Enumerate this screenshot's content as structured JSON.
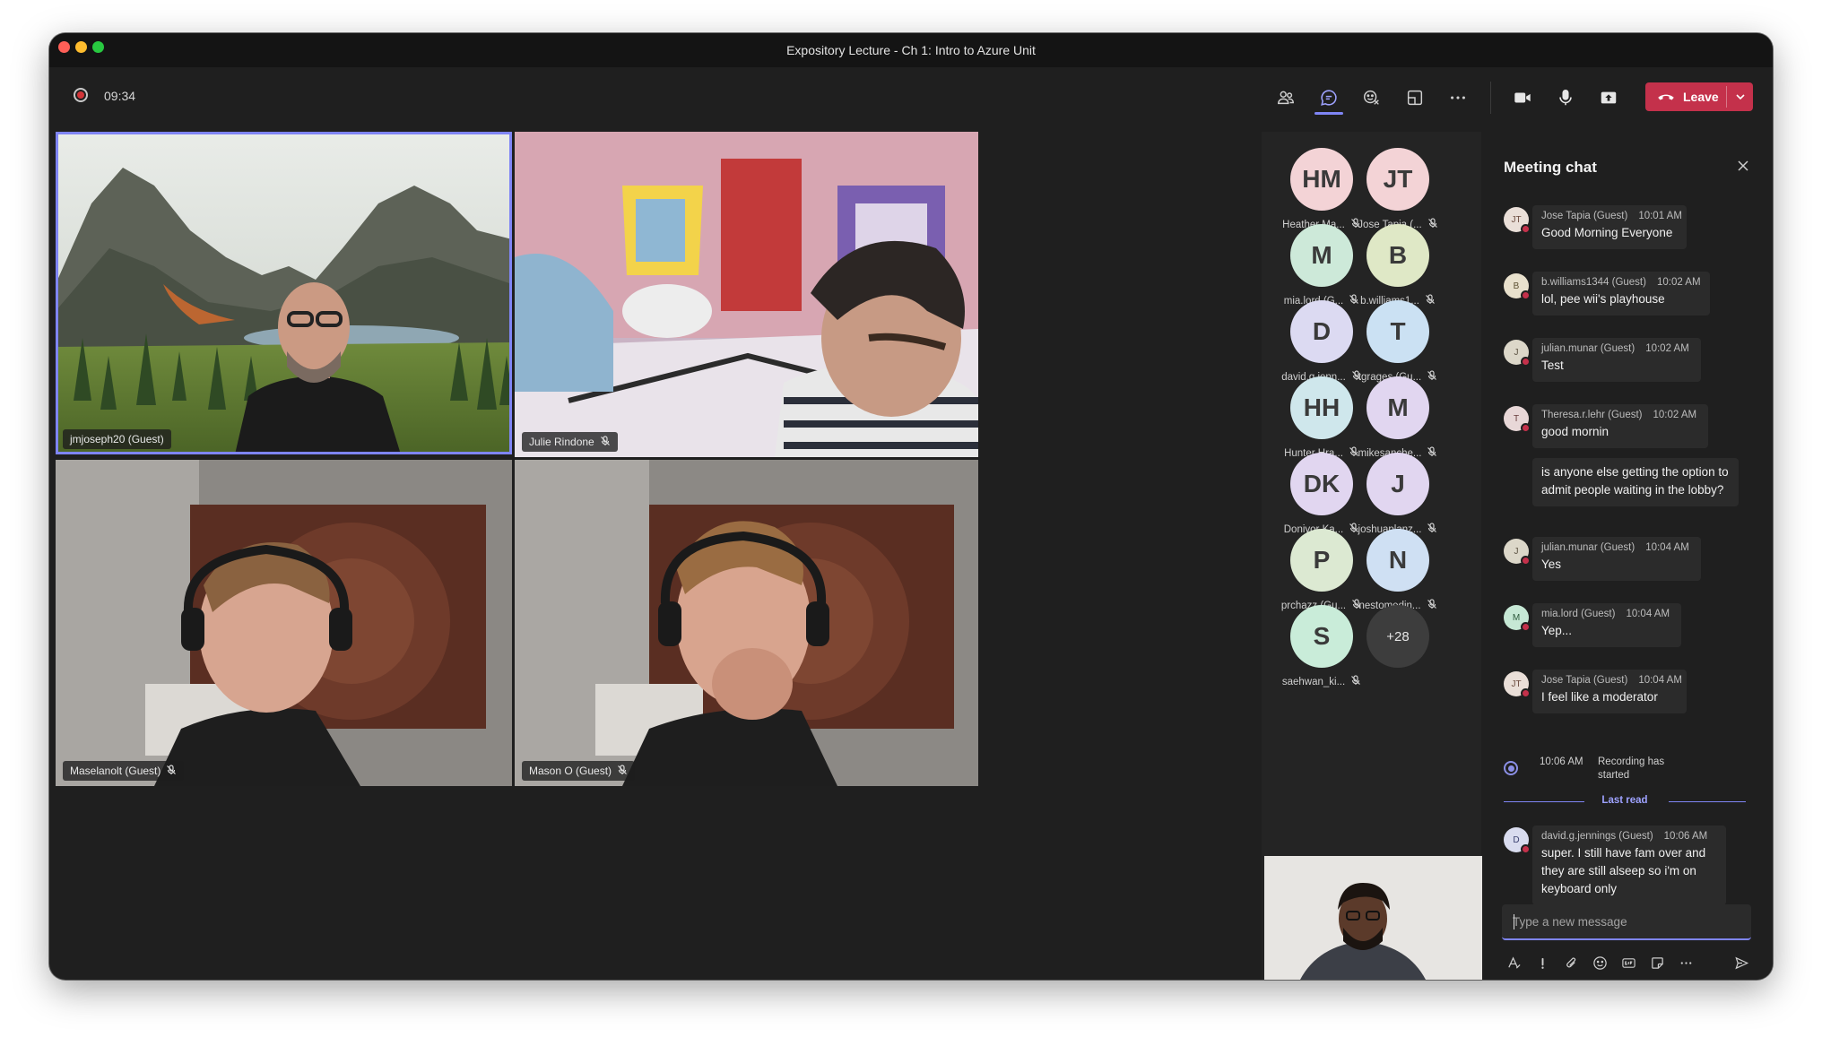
{
  "window": {
    "title": "Expository Lecture - Ch 1: Intro to Azure Unit"
  },
  "toolbar": {
    "timer": "09:34",
    "icons": [
      "people-icon",
      "chat-icon",
      "reactions-icon",
      "view-icon",
      "more-icon",
      "camera-icon",
      "mic-icon",
      "share-icon"
    ],
    "leave_label": "Leave"
  },
  "tiles": [
    {
      "name": "jmjoseph20 (Guest)",
      "muted": false,
      "speaking": true
    },
    {
      "name": "Julie Rindone",
      "muted": true
    },
    {
      "name": "Maselanolt (Guest)",
      "muted": true
    },
    {
      "name": "Mason O (Guest)",
      "muted": true
    }
  ],
  "roster": [
    {
      "initials": "HM",
      "name": "Heather Ma...",
      "color": "#f3d3d6"
    },
    {
      "initials": "JT",
      "name": "Jose Tapia (...",
      "color": "#f3d3d6"
    },
    {
      "initials": "M",
      "name": "mia.lord (G...",
      "color": "#cde9d9"
    },
    {
      "initials": "B",
      "name": "b.williams1...",
      "color": "#dfe8c6"
    },
    {
      "initials": "D",
      "name": "david.g.jenn...",
      "color": "#dcdaf2"
    },
    {
      "initials": "T",
      "name": "tgrages (Gu...",
      "color": "#cbe1f3"
    },
    {
      "initials": "HH",
      "name": "Hunter Hra...",
      "color": "#cfe7ec"
    },
    {
      "initials": "M",
      "name": "mikesanche...",
      "color": "#e1d6f0"
    },
    {
      "initials": "DK",
      "name": "Doniyor Ka...",
      "color": "#e1d6f0"
    },
    {
      "initials": "J",
      "name": "joshuaplanz...",
      "color": "#e1d6f0"
    },
    {
      "initials": "P",
      "name": "prchazz (Gu...",
      "color": "#dce9d2"
    },
    {
      "initials": "N",
      "name": "nestomedin...",
      "color": "#cfe0f3"
    },
    {
      "initials": "S",
      "name": "saehwan_ki...",
      "color": "#c9ecd9"
    }
  ],
  "roster_more": "+28",
  "chat": {
    "title": "Meeting chat",
    "messages": [
      {
        "initials": "JT",
        "sender": "Jose Tapia (Guest)",
        "time": "10:01 AM",
        "text": "Good Morning Everyone"
      },
      {
        "initials": "B",
        "sender": "b.williams1344 (Guest)",
        "time": "10:02 AM",
        "text": "lol, pee wii's playhouse"
      },
      {
        "initials": "J",
        "sender": "julian.munar (Guest)",
        "time": "10:02 AM",
        "text": "Test"
      },
      {
        "initials": "T",
        "sender": "Theresa.r.lehr (Guest)",
        "time": "10:02 AM",
        "text": "good mornin"
      },
      {
        "initials": "",
        "sender": "",
        "time": "",
        "text": "is anyone else getting the option to admit people waiting in the lobby?"
      },
      {
        "initials": "J",
        "sender": "julian.munar (Guest)",
        "time": "10:04 AM",
        "text": "Yes"
      },
      {
        "initials": "M",
        "sender": "mia.lord (Guest)",
        "time": "10:04 AM",
        "text": "Yep..."
      },
      {
        "initials": "JT",
        "sender": "Jose Tapia (Guest)",
        "time": "10:04 AM",
        "text": "I feel like a moderator"
      },
      {
        "initials": "D",
        "sender": "david.g.jennings (Guest)",
        "time": "10:06 AM",
        "text": "super. I still have fam over and they are still alseep so i'm on keyboard only"
      }
    ],
    "recording": {
      "time": "10:06 AM",
      "text": "Recording has started"
    },
    "last_read": "Last read",
    "compose_placeholder": "Type a new message"
  },
  "colors": {
    "accent": "#7f85f5",
    "leave": "#c4314b",
    "bg": "#1f1f1f"
  }
}
